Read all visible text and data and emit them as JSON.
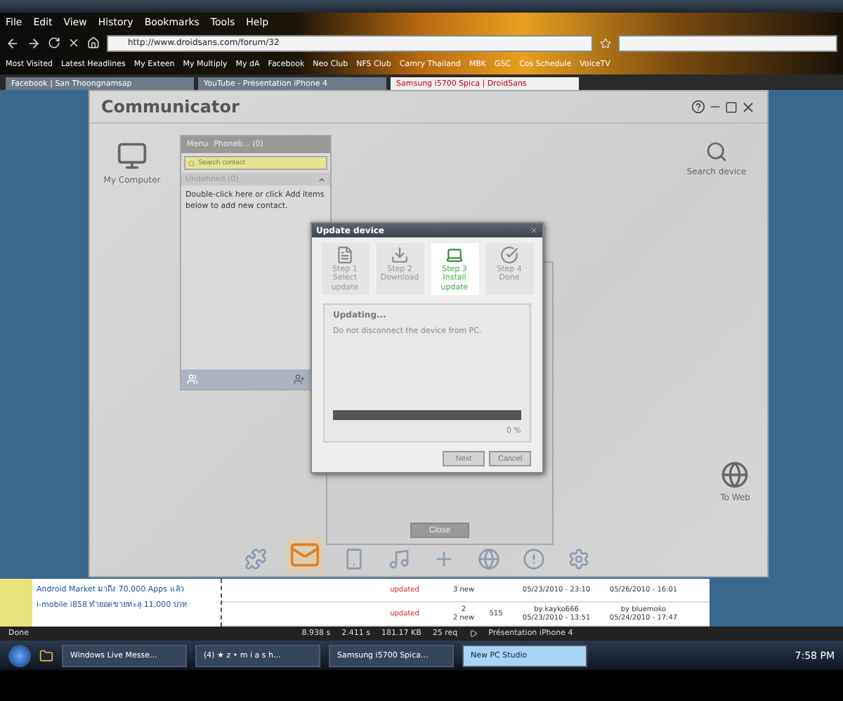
{
  "browser": {
    "menu": [
      "File",
      "Edit",
      "View",
      "History",
      "Bookmarks",
      "Tools",
      "Help"
    ],
    "url": "http://www.droidsans.com/forum/32",
    "bookmarks": [
      "Most Visited",
      "Latest Headlines",
      "My Exteen",
      "My Multiply",
      "My dA",
      "Facebook",
      "Neo Club",
      "NFS Club",
      "Camry Thailand",
      "MBK",
      "GSC",
      "Cos Schedule",
      "VoiceTV"
    ],
    "tabs": [
      {
        "label": "Facebook | San Thoongnamsap",
        "selected": false
      },
      {
        "label": "YouTube - Présentation iPhone 4",
        "selected": false
      },
      {
        "label": "Samsung i5700 Spica | DroidSans",
        "selected": true
      }
    ]
  },
  "page": {
    "news": [
      "Android Market มาถึง 70,000 Apps แล้ว",
      "i-mobile i858 ทำยอดขายทะลุ 11,000 บาท"
    ],
    "topics": [
      {
        "badge": "updated",
        "new": "3 new",
        "started": "05/23/2010 - 23:10",
        "last": "05/26/2010 - 16:01"
      },
      {
        "badge": "updated",
        "replies": "2",
        "new": "2 new",
        "views": "515",
        "started": "05/23/2010 - 13:51",
        "starter": "by kayko666",
        "last": "05/24/2010 - 17:47",
        "poster": "by bluemoko"
      }
    ]
  },
  "communicator": {
    "title": "Communicator",
    "my_computer": "My Computer",
    "search_device": "Search device",
    "to_web": "To Web",
    "contacts": {
      "menu": "Menu",
      "phonebook": "Phoneb... (0)",
      "placeholder": "Search contact",
      "group": "Undefined (0)",
      "hint": "Double-click here or click Add items below to add new contact."
    },
    "close": "Close",
    "dock": [
      {
        "kind": "puzzle",
        "selected": false
      },
      {
        "kind": "messages",
        "selected": true
      },
      {
        "kind": "phone",
        "selected": false
      },
      {
        "kind": "music",
        "selected": false
      },
      {
        "kind": "plus",
        "selected": false
      },
      {
        "kind": "globe",
        "selected": false
      },
      {
        "kind": "alert",
        "selected": false
      },
      {
        "kind": "gear",
        "selected": false
      }
    ],
    "dialog": {
      "title": "Update device",
      "steps": [
        {
          "step": "Step 1",
          "label": "Select update",
          "kind": "list",
          "selected": false
        },
        {
          "step": "Step 2",
          "label": "Download",
          "kind": "download",
          "selected": false
        },
        {
          "step": "Step 3",
          "label": "Install update",
          "kind": "install",
          "selected": true
        },
        {
          "step": "Step 4",
          "label": "Done",
          "kind": "done",
          "selected": false
        }
      ],
      "status": "Updating...",
      "message": "Do not disconnect the device from PC.",
      "level": 0,
      "percent": "0 %",
      "buttons": [
        {
          "label": "Next",
          "disabled": true
        },
        {
          "label": "Cancel",
          "disabled": true
        }
      ]
    }
  },
  "status_bar": {
    "left": "Done",
    "metrics": [
      "8.938 s",
      "2.411 s",
      "181.17 KB",
      "25 req"
    ],
    "media": "Présentation iPhone 4"
  },
  "taskbar": {
    "items": [
      {
        "label": "Windows Live Messe...",
        "selected": false
      },
      {
        "label": "(4) ★ z • m i a s h...",
        "selected": false
      },
      {
        "label": "Samsung i5700 Spica...",
        "selected": false
      },
      {
        "label": "New PC Studio",
        "selected": true
      }
    ],
    "clock": "7:58 PM"
  }
}
